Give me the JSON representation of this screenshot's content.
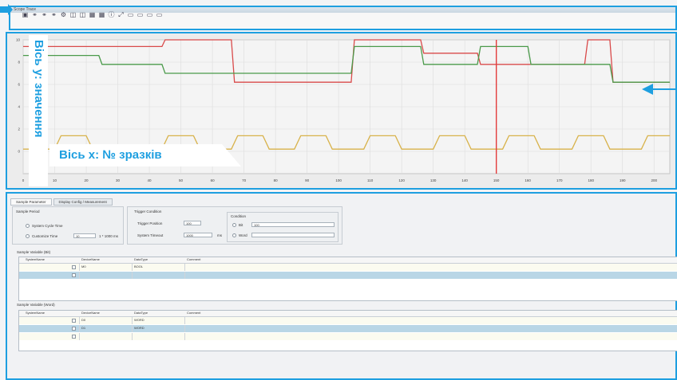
{
  "window": {
    "title": "Scope Trace"
  },
  "toolbar": {
    "icons": [
      "save-icon",
      "link-icon",
      "link-icon",
      "link-icon",
      "gear-icon",
      "chart-icon",
      "chart-icon",
      "grid-icon",
      "grid-icon",
      "info-icon",
      "cursor-icon",
      "marker-icon",
      "marker-icon",
      "marker-icon",
      "marker-icon"
    ]
  },
  "annotations": {
    "y_axis_label": "Вісь у: значення",
    "x_axis_label": "Вісь х: № зразків",
    "accent_color": "#1e9fe0"
  },
  "chart_data": {
    "type": "line",
    "x": [
      0,
      10,
      20,
      30,
      40,
      50,
      60,
      70,
      80,
      90,
      100,
      110,
      120,
      130,
      140,
      150,
      160,
      170,
      180,
      190,
      200
    ],
    "xlim": [
      0,
      205
    ],
    "ylim": [
      -2,
      10
    ],
    "xticks": [
      "0",
      "10",
      "20",
      "30",
      "40",
      "50",
      "60",
      "70",
      "80",
      "90",
      "100",
      "110",
      "120",
      "130",
      "140",
      "150",
      "160",
      "170",
      "180",
      "190",
      "200"
    ],
    "yticks": [
      "10",
      "8",
      "6",
      "4",
      "2",
      "0"
    ],
    "grid": true,
    "series": [
      {
        "color": "#d94a4a",
        "points": [
          [
            0,
            9.4
          ],
          [
            24,
            9.4
          ],
          [
            25,
            9.4
          ],
          [
            44,
            9.4
          ],
          [
            45,
            10
          ],
          [
            66,
            10
          ],
          [
            67,
            6.2
          ],
          [
            104,
            6.2
          ],
          [
            105,
            10
          ],
          [
            126,
            10
          ],
          [
            127,
            8.8
          ],
          [
            144,
            8.8
          ],
          [
            145,
            7.8
          ],
          [
            178,
            7.8
          ],
          [
            179,
            10
          ],
          [
            186,
            10
          ],
          [
            187,
            6.2
          ],
          [
            205,
            6.2
          ]
        ]
      },
      {
        "color": "#4a9a4a",
        "points": [
          [
            0,
            8.6
          ],
          [
            24,
            8.6
          ],
          [
            25,
            7.8
          ],
          [
            44,
            7.8
          ],
          [
            45,
            7
          ],
          [
            66,
            7
          ],
          [
            67,
            7
          ],
          [
            86,
            7
          ],
          [
            87,
            7
          ],
          [
            104,
            7
          ],
          [
            105,
            9.4
          ],
          [
            126,
            9.4
          ],
          [
            127,
            7.8
          ],
          [
            144,
            7.8
          ],
          [
            145,
            9.4
          ],
          [
            160,
            9.4
          ],
          [
            161,
            7.8
          ],
          [
            186,
            7.8
          ],
          [
            187,
            6.2
          ],
          [
            205,
            6.2
          ]
        ]
      },
      {
        "color": "#d8b24a",
        "points": [
          [
            0,
            0.2
          ],
          [
            10,
            0.2
          ],
          [
            12,
            1.4
          ],
          [
            20,
            1.4
          ],
          [
            22,
            0.2
          ],
          [
            44,
            0.2
          ],
          [
            46,
            1.4
          ],
          [
            54,
            1.4
          ],
          [
            56,
            0.2
          ],
          [
            66,
            0.2
          ],
          [
            68,
            1.4
          ],
          [
            76,
            1.4
          ],
          [
            78,
            0.2
          ],
          [
            86,
            0.2
          ],
          [
            88,
            1.4
          ],
          [
            96,
            1.4
          ],
          [
            98,
            0.2
          ],
          [
            108,
            0.2
          ],
          [
            110,
            1.4
          ],
          [
            118,
            1.4
          ],
          [
            120,
            0.2
          ],
          [
            130,
            0.2
          ],
          [
            132,
            1.4
          ],
          [
            140,
            1.4
          ],
          [
            142,
            0.2
          ],
          [
            152,
            0.2
          ],
          [
            154,
            1.4
          ],
          [
            162,
            1.4
          ],
          [
            164,
            0.2
          ],
          [
            174,
            0.2
          ],
          [
            176,
            1.4
          ],
          [
            184,
            1.4
          ],
          [
            186,
            0.2
          ],
          [
            196,
            0.2
          ],
          [
            198,
            1.4
          ],
          [
            205,
            1.4
          ]
        ]
      }
    ],
    "cursor_x": 150,
    "cursor_color": "#e23b3b"
  },
  "panel": {
    "tabs": [
      "Sample Parameter",
      "Display Config / Measurement"
    ],
    "sample_period_label": "Sample Period",
    "system_cycle_label": "System Cycle Time",
    "custom_time_label": "Customize Time",
    "custom_time_value": "10",
    "custom_time_unit": "1 * 1000 ms",
    "trigger_label": "Trigger Condition",
    "trigger_position_label": "Trigger Position",
    "trigger_position_value": "100",
    "system_timeout_label": "System Timeout",
    "system_timeout_value": "1000",
    "system_timeout_unit": "ms",
    "condition_label": "Condition",
    "condition_bit_label": "Bit",
    "condition_bit_value": "100",
    "condition_word_label": "Word",
    "bit_section_label": "Sample Variable (Bit)",
    "word_section_label": "Sample Variable (Word)",
    "bit_table": {
      "headers": [
        "SystemName",
        "DeviceName",
        "DataType",
        "Comment"
      ],
      "rows": [
        [
          "",
          "M0",
          "BOOL",
          ""
        ],
        [
          "",
          "",
          "",
          ""
        ]
      ]
    },
    "word_table": {
      "headers": [
        "SystemName",
        "DeviceName",
        "DataType",
        "Comment"
      ],
      "rows": [
        [
          "",
          "D0",
          "WORD",
          ""
        ],
        [
          "",
          "D1",
          "WORD",
          ""
        ],
        [
          "",
          "",
          "",
          ""
        ]
      ]
    }
  }
}
